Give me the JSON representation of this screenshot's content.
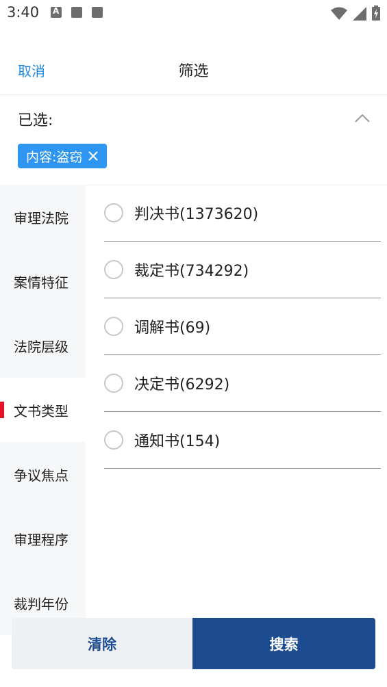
{
  "status_bar": {
    "time": "3:40",
    "left_icons": [
      "a-icon",
      "book-icon",
      "book-icon"
    ],
    "right_icons": [
      "wifi-icon",
      "signal-icon",
      "battery-charging-icon"
    ]
  },
  "header": {
    "cancel_label": "取消",
    "title": "筛选"
  },
  "selected": {
    "label": "已选:",
    "chips": [
      {
        "text": "内容:盗窃"
      }
    ]
  },
  "categories": [
    {
      "label": "审理法院"
    },
    {
      "label": "案情特征"
    },
    {
      "label": "法院层级"
    },
    {
      "label": "文书类型",
      "active": true
    },
    {
      "label": "争议焦点"
    },
    {
      "label": "审理程序"
    },
    {
      "label": "裁判年份"
    }
  ],
  "options": [
    {
      "label": "判决书(1373620)"
    },
    {
      "label": "裁定书(734292)"
    },
    {
      "label": "调解书(69)"
    },
    {
      "label": "决定书(6292)"
    },
    {
      "label": "通知书(154)"
    }
  ],
  "buttons": {
    "clear_label": "清除",
    "search_label": "搜索"
  },
  "colors": {
    "accent": "#1e88e5",
    "chip": "#2e96f2",
    "primary_button": "#1d4b8f",
    "active_indicator": "#e8102a"
  }
}
